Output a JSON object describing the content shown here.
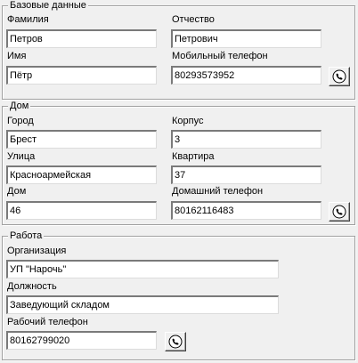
{
  "basic": {
    "legend": "Базовые данные",
    "surname_label": "Фамилия",
    "surname_value": "Петров",
    "patronymic_label": "Отчество",
    "patronymic_value": "Петрович",
    "name_label": "Имя",
    "name_value": "Пётр",
    "mobile_label": "Мобильный телефон",
    "mobile_value": "80293573952",
    "call_icon": "phone-icon"
  },
  "home": {
    "legend": "Дом",
    "city_label": "Город",
    "city_value": "Брест",
    "building_label": "Корпус",
    "building_value": "3",
    "street_label": "Улица",
    "street_value": "Красноармейская",
    "apartment_label": "Квартира",
    "apartment_value": "37",
    "house_label": "Дом",
    "house_value": "46",
    "home_phone_label": "Домашний телефон",
    "home_phone_value": "80162116483",
    "call_icon": "phone-icon"
  },
  "work": {
    "legend": "Работа",
    "organization_label": "Организация",
    "organization_value": "УП \"Нарочь\"",
    "position_label": "Должность",
    "position_value": "Заведующий складом",
    "work_phone_label": "Рабочий телефон",
    "work_phone_value": "80162799020",
    "call_icon": "phone-icon"
  }
}
